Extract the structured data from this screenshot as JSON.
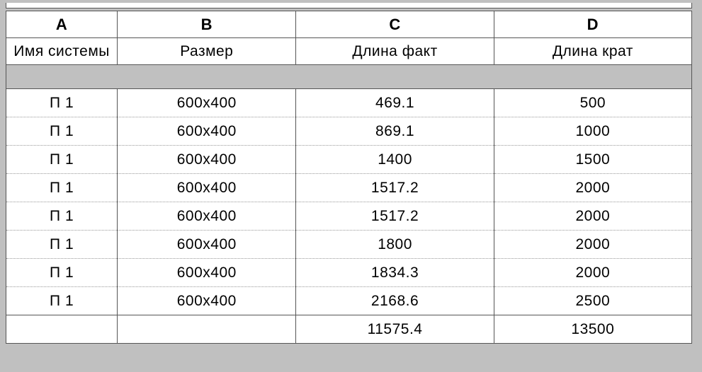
{
  "columns": {
    "letters": [
      "A",
      "B",
      "C",
      "D"
    ],
    "labels": [
      "Имя системы",
      "Размер",
      "Длина факт",
      "Длина крат"
    ]
  },
  "rows": [
    {
      "system": "П 1",
      "size": "600x400",
      "length_fact": "469.1",
      "length_krat": "500"
    },
    {
      "system": "П 1",
      "size": "600x400",
      "length_fact": "869.1",
      "length_krat": "1000"
    },
    {
      "system": "П 1",
      "size": "600x400",
      "length_fact": "1400",
      "length_krat": "1500"
    },
    {
      "system": "П 1",
      "size": "600x400",
      "length_fact": "1517.2",
      "length_krat": "2000"
    },
    {
      "system": "П 1",
      "size": "600x400",
      "length_fact": "1517.2",
      "length_krat": "2000"
    },
    {
      "system": "П 1",
      "size": "600x400",
      "length_fact": "1800",
      "length_krat": "2000"
    },
    {
      "system": "П 1",
      "size": "600x400",
      "length_fact": "1834.3",
      "length_krat": "2000"
    },
    {
      "system": "П 1",
      "size": "600x400",
      "length_fact": "2168.6",
      "length_krat": "2500"
    }
  ],
  "totals": {
    "system": "",
    "size": "",
    "length_fact": "11575.4",
    "length_krat": "13500"
  },
  "chart_data": {
    "type": "table",
    "columns": [
      "Имя системы",
      "Размер",
      "Длина факт",
      "Длина крат"
    ],
    "data": [
      [
        "П 1",
        "600x400",
        469.1,
        500
      ],
      [
        "П 1",
        "600x400",
        869.1,
        1000
      ],
      [
        "П 1",
        "600x400",
        1400,
        1500
      ],
      [
        "П 1",
        "600x400",
        1517.2,
        2000
      ],
      [
        "П 1",
        "600x400",
        1517.2,
        2000
      ],
      [
        "П 1",
        "600x400",
        1800,
        2000
      ],
      [
        "П 1",
        "600x400",
        1834.3,
        2000
      ],
      [
        "П 1",
        "600x400",
        2168.6,
        2500
      ]
    ],
    "totals": {
      "Длина факт": 11575.4,
      "Длина крат": 13500
    }
  }
}
